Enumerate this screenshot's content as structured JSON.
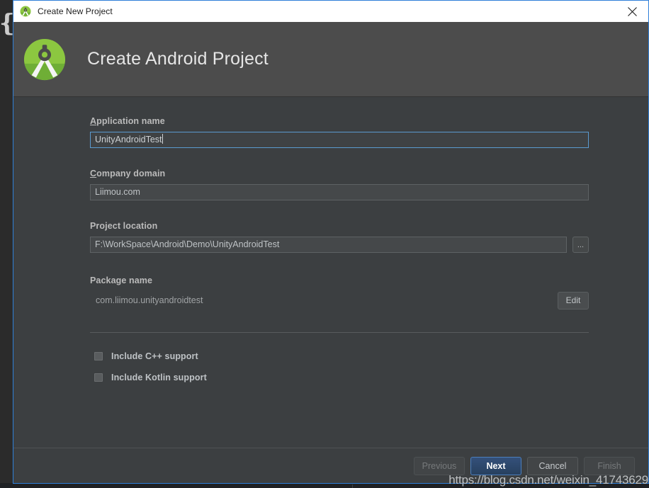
{
  "window": {
    "title": "Create New Project",
    "icon": "android-studio-icon",
    "close_label": "close-icon"
  },
  "header": {
    "title": "Create Android Project",
    "logo": "android-studio-logo"
  },
  "form": {
    "application_name": {
      "label_mnemonic": "A",
      "label_rest": "pplication name",
      "value": "UnityAndroidTest",
      "focused": true
    },
    "company_domain": {
      "label_mnemonic": "C",
      "label_rest": "ompany domain",
      "value": "Liimou.com",
      "focused": false
    },
    "project_location": {
      "label": "Project location",
      "value": "F:\\WorkSpace\\Android\\Demo\\UnityAndroidTest",
      "browse_label": "..."
    },
    "package_name": {
      "label": "Package name",
      "value": "com.liimou.unityandroidtest",
      "edit_label": "Edit"
    },
    "options": [
      {
        "label": "Include C++ support",
        "checked": false
      },
      {
        "label": "Include Kotlin support",
        "checked": false
      }
    ]
  },
  "footer": {
    "buttons": [
      {
        "label": "Previous",
        "state": "disabled"
      },
      {
        "label": "Next",
        "state": "default"
      },
      {
        "label": "Cancel",
        "state": "enabled"
      },
      {
        "label": "Finish",
        "state": "disabled"
      }
    ]
  },
  "watermark": {
    "text": "https://blog.csdn.net/weixin_41743629"
  },
  "colors": {
    "accent": "#2f7fd8",
    "header_band": "#4c4c4c",
    "dialog_bg": "#3c3f41",
    "primary_button": "#34507a",
    "logo_green": "#7ec242"
  }
}
